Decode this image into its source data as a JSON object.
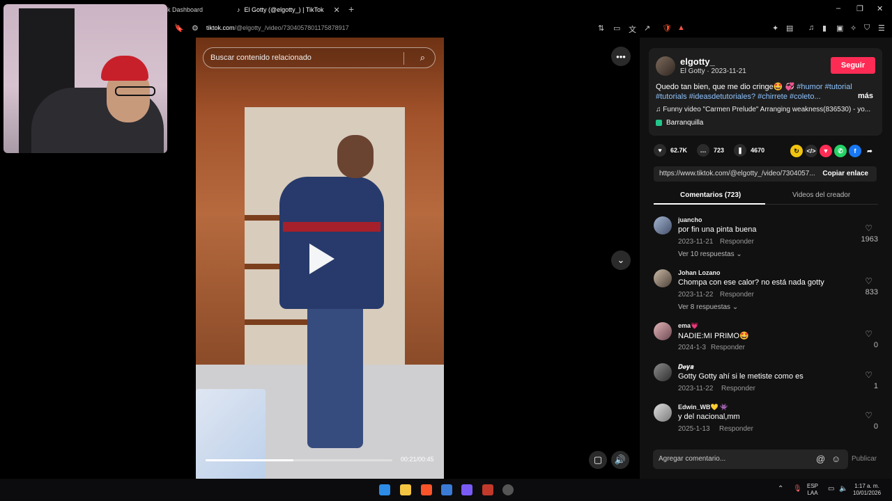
{
  "browser": {
    "tabs": [
      {
        "label": "k Dashboard"
      },
      {
        "label": "El Gotty (@elgotty_) | TikTok"
      }
    ],
    "new_tab": "+",
    "url_host": "tiktok.com",
    "url_path": "/@elgotty_/video/7304057801175878917",
    "window_controls": [
      "–",
      "❐",
      "✕"
    ]
  },
  "video": {
    "search_placeholder": "Buscar contenido relacionado",
    "time": "00:21/00:45",
    "progress": 0.47,
    "more_label": "•••"
  },
  "post": {
    "username": "elgotty_",
    "subtitle": "El Gotty · 2023-11-21",
    "follow_label": "Seguir",
    "description_text": "Quedo tan bien, que me dio cringe🤩 💞 ",
    "hashtags_line1": "#humor #tutorial",
    "hashtags_line2": "#tutorials #ideasdetutoriales? #chirrete #coleto...",
    "more_label": "más",
    "music": "Funny video \"Carmen Prelude\" Arranging weakness(836530) - yo...",
    "location": "Barranquilla",
    "likes": "62.7K",
    "comments_count": "723",
    "saves": "4670",
    "link": "https://www.tiktok.com/@elgotty_/video/7304057...",
    "copy_label": "Copiar enlace"
  },
  "tabs": {
    "comments": "Comentarios (723)",
    "creator_videos": "Videos del creador"
  },
  "comments": [
    {
      "name": "juancho",
      "text": "por fin una pinta buena",
      "date": "2023-11-21",
      "reply": "Responder",
      "likes": "1963",
      "more": "Ver 10 respuestas ⌄"
    },
    {
      "name": "Johan Lozano",
      "text": "Chompa con ese calor? no está nada gotty",
      "date": "2023-11-22",
      "reply": "Responder",
      "likes": "833",
      "more": "Ver 8 respuestas ⌄"
    },
    {
      "name": "ema💗",
      "text": "NADIE:MI PRIMO🤩",
      "date": "2024-1-3",
      "reply": "Responder",
      "likes": "0",
      "more": ""
    },
    {
      "name": "𝑫𝒆𝒚𝒂",
      "text": "Gotty Gotty ahí si le metiste como es",
      "date": "2023-11-22",
      "reply": "Responder",
      "likes": "1",
      "more": ""
    },
    {
      "name": "Edwin_WB💛 👾",
      "text": "y del nacional,mm",
      "date": "2025-1-13",
      "reply": "Responder",
      "likes": "0",
      "more": ""
    }
  ],
  "composer": {
    "placeholder": "Agregar comentario...",
    "publish": "Publicar"
  },
  "taskbar": {
    "lang_top": "ESP",
    "lang_bottom": "LAA",
    "time": "1:17 a. m.",
    "date": "10/01/2026"
  },
  "colors": {
    "accent": "#fe2c55",
    "hashtag": "#8fc4ff",
    "panel": "#111111"
  }
}
